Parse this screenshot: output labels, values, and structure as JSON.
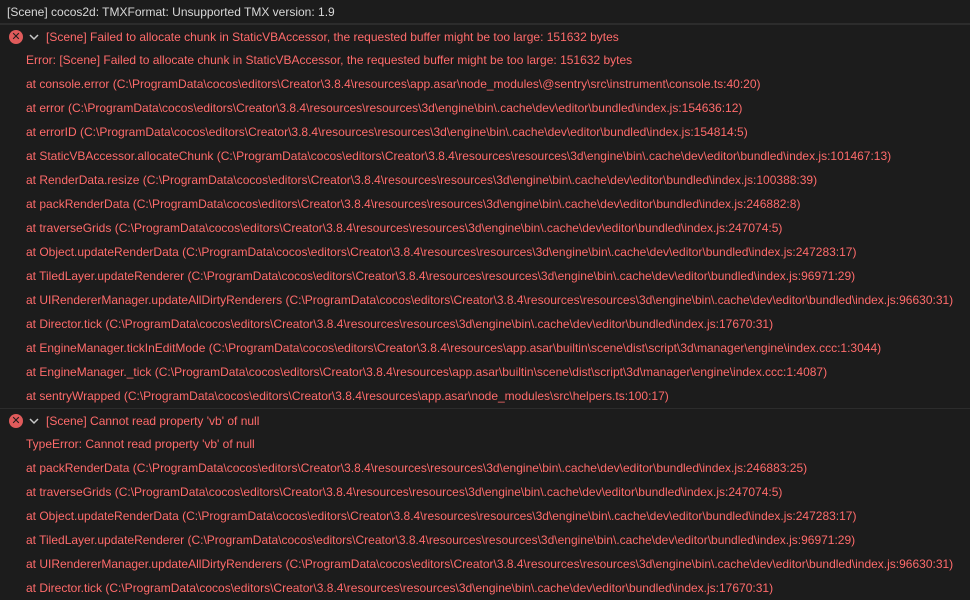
{
  "log": {
    "message": "[Scene] cocos2d: TMXFormat: Unsupported TMX version: 1.9"
  },
  "errors": [
    {
      "title": "[Scene] Failed to allocate chunk in StaticVBAccessor, the requested buffer might be too large: 151632 bytes",
      "icon": "error-icon",
      "expanded": true,
      "lines": [
        "Error: [Scene] Failed to allocate chunk in StaticVBAccessor, the requested buffer might be too large: 151632 bytes",
        "at console.error (C:\\ProgramData\\cocos\\editors\\Creator\\3.8.4\\resources\\app.asar\\node_modules\\@sentry\\src\\instrument\\console.ts:40:20)",
        "at error (C:\\ProgramData\\cocos\\editors\\Creator\\3.8.4\\resources\\resources\\3d\\engine\\bin\\.cache\\dev\\editor\\bundled\\index.js:154636:12)",
        "at errorID (C:\\ProgramData\\cocos\\editors\\Creator\\3.8.4\\resources\\resources\\3d\\engine\\bin\\.cache\\dev\\editor\\bundled\\index.js:154814:5)",
        "at StaticVBAccessor.allocateChunk (C:\\ProgramData\\cocos\\editors\\Creator\\3.8.4\\resources\\resources\\3d\\engine\\bin\\.cache\\dev\\editor\\bundled\\index.js:101467:13)",
        "at RenderData.resize (C:\\ProgramData\\cocos\\editors\\Creator\\3.8.4\\resources\\resources\\3d\\engine\\bin\\.cache\\dev\\editor\\bundled\\index.js:100388:39)",
        "at packRenderData (C:\\ProgramData\\cocos\\editors\\Creator\\3.8.4\\resources\\resources\\3d\\engine\\bin\\.cache\\dev\\editor\\bundled\\index.js:246882:8)",
        "at traverseGrids (C:\\ProgramData\\cocos\\editors\\Creator\\3.8.4\\resources\\resources\\3d\\engine\\bin\\.cache\\dev\\editor\\bundled\\index.js:247074:5)",
        "at Object.updateRenderData (C:\\ProgramData\\cocos\\editors\\Creator\\3.8.4\\resources\\resources\\3d\\engine\\bin\\.cache\\dev\\editor\\bundled\\index.js:247283:17)",
        "at TiledLayer.updateRenderer (C:\\ProgramData\\cocos\\editors\\Creator\\3.8.4\\resources\\resources\\3d\\engine\\bin\\.cache\\dev\\editor\\bundled\\index.js:96971:29)",
        "at UIRendererManager.updateAllDirtyRenderers (C:\\ProgramData\\cocos\\editors\\Creator\\3.8.4\\resources\\resources\\3d\\engine\\bin\\.cache\\dev\\editor\\bundled\\index.js:96630:31)",
        "at Director.tick (C:\\ProgramData\\cocos\\editors\\Creator\\3.8.4\\resources\\resources\\3d\\engine\\bin\\.cache\\dev\\editor\\bundled\\index.js:17670:31)",
        "at EngineManager.tickInEditMode (C:\\ProgramData\\cocos\\editors\\Creator\\3.8.4\\resources\\app.asar\\builtin\\scene\\dist\\script\\3d\\manager\\engine\\index.ccc:1:3044)",
        "at EngineManager._tick (C:\\ProgramData\\cocos\\editors\\Creator\\3.8.4\\resources\\app.asar\\builtin\\scene\\dist\\script\\3d\\manager\\engine\\index.ccc:1:4087)",
        "at sentryWrapped (C:\\ProgramData\\cocos\\editors\\Creator\\3.8.4\\resources\\app.asar\\node_modules\\src\\helpers.ts:100:17)"
      ]
    },
    {
      "title": "[Scene] Cannot read property 'vb' of null",
      "icon": "error-icon",
      "expanded": true,
      "lines": [
        "TypeError: Cannot read property 'vb' of null",
        "at packRenderData (C:\\ProgramData\\cocos\\editors\\Creator\\3.8.4\\resources\\resources\\3d\\engine\\bin\\.cache\\dev\\editor\\bundled\\index.js:246883:25)",
        "at traverseGrids (C:\\ProgramData\\cocos\\editors\\Creator\\3.8.4\\resources\\resources\\3d\\engine\\bin\\.cache\\dev\\editor\\bundled\\index.js:247074:5)",
        "at Object.updateRenderData (C:\\ProgramData\\cocos\\editors\\Creator\\3.8.4\\resources\\resources\\3d\\engine\\bin\\.cache\\dev\\editor\\bundled\\index.js:247283:17)",
        "at TiledLayer.updateRenderer (C:\\ProgramData\\cocos\\editors\\Creator\\3.8.4\\resources\\resources\\3d\\engine\\bin\\.cache\\dev\\editor\\bundled\\index.js:96971:29)",
        "at UIRendererManager.updateAllDirtyRenderers (C:\\ProgramData\\cocos\\editors\\Creator\\3.8.4\\resources\\resources\\3d\\engine\\bin\\.cache\\dev\\editor\\bundled\\index.js:96630:31)",
        "at Director.tick (C:\\ProgramData\\cocos\\editors\\Creator\\3.8.4\\resources\\resources\\3d\\engine\\bin\\.cache\\dev\\editor\\bundled\\index.js:17670:31)"
      ]
    }
  ],
  "colors": {
    "background": "#1c1c1c",
    "log_text": "#d8d8d8",
    "error_text": "#ff6b6b",
    "error_icon": "#e05b5b"
  }
}
